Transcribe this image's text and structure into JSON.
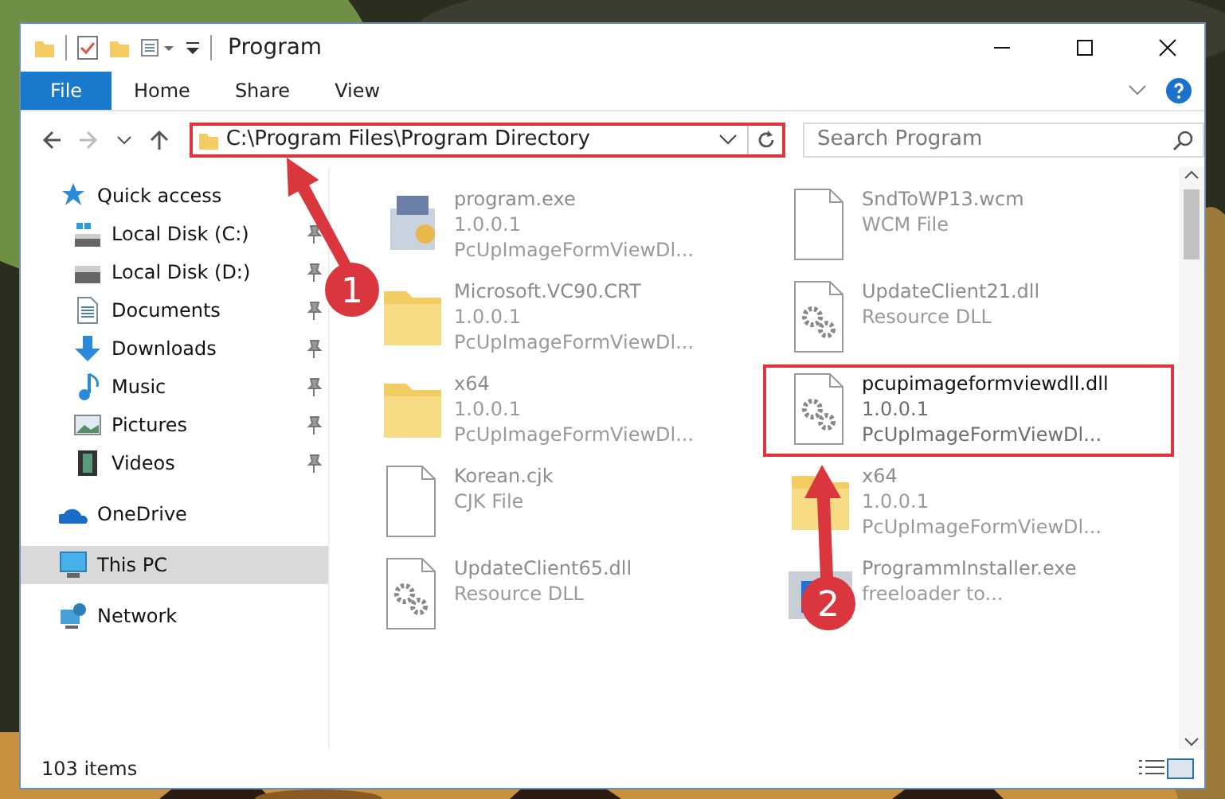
{
  "window": {
    "title": "Program"
  },
  "ribbon_tabs": [
    {
      "label": "File",
      "kind": "menu"
    },
    {
      "label": "Home",
      "kind": "tab"
    },
    {
      "label": "Share",
      "kind": "tab"
    },
    {
      "label": "View",
      "kind": "tab"
    }
  ],
  "address_bar": {
    "path": "C:\\Program Files\\Program Directory"
  },
  "search": {
    "placeholder": "Search Program"
  },
  "navigation": [
    {
      "label": "Quick access",
      "kind": "star",
      "selected": false,
      "children": [
        {
          "label": "Local Disk (C:)",
          "kind": "drive-c",
          "pinned": true,
          "selected": false
        },
        {
          "label": "Local Disk (D:)",
          "kind": "drive",
          "pinned": true,
          "selected": false
        },
        {
          "label": "Documents",
          "kind": "documents",
          "pinned": true,
          "selected": false
        },
        {
          "label": "Downloads",
          "kind": "downloads",
          "pinned": true,
          "selected": false
        },
        {
          "label": "Music",
          "kind": "music",
          "pinned": true,
          "selected": false
        },
        {
          "label": "Pictures",
          "kind": "pictures",
          "pinned": true,
          "selected": false
        },
        {
          "label": "Videos",
          "kind": "videos",
          "pinned": true,
          "selected": false
        }
      ]
    },
    {
      "label": "OneDrive",
      "kind": "cloud",
      "selected": false
    },
    {
      "label": "This PC",
      "kind": "pc",
      "selected": true
    },
    {
      "label": "Network",
      "kind": "network",
      "selected": false
    }
  ],
  "files": [
    {
      "name": "program.exe",
      "details": [
        "1.0.0.1",
        "PcUpImageFormViewDl..."
      ],
      "kind": "exe",
      "highlighted": false
    },
    {
      "name": "SndToWP13.wcm",
      "details": [
        "WCM File"
      ],
      "kind": "file",
      "highlighted": false
    },
    {
      "name": "Microsoft.VC90.CRT",
      "details": [
        "1.0.0.1",
        "PcUpImageFormViewDl..."
      ],
      "kind": "folder",
      "highlighted": false
    },
    {
      "name": "UpdateClient21.dll",
      "details": [
        "Resource DLL"
      ],
      "kind": "dll",
      "highlighted": false
    },
    {
      "name": "x64",
      "details": [
        "1.0.0.1",
        "PcUpImageFormViewDl..."
      ],
      "kind": "folder",
      "highlighted": false
    },
    {
      "name": "pcupimageformviewdll.dll",
      "details": [
        "1.0.0.1",
        "PcUpImageFormViewDl..."
      ],
      "kind": "dll",
      "highlighted": true
    },
    {
      "name": "Korean.cjk",
      "details": [
        "CJK File"
      ],
      "kind": "file",
      "highlighted": false
    },
    {
      "name": "x64",
      "details": [
        "1.0.0.1",
        "PcUpImageFormViewDl..."
      ],
      "kind": "folder",
      "highlighted": false
    },
    {
      "name": "UpdateClient65.dll",
      "details": [
        "Resource DLL"
      ],
      "kind": "dll",
      "highlighted": false
    },
    {
      "name": "ProgrammInstaller.exe",
      "details": [
        "freeloader to..."
      ],
      "kind": "installer",
      "highlighted": false
    }
  ],
  "status_bar": {
    "item_count": "103 items"
  },
  "annotations": [
    {
      "number": "1"
    },
    {
      "number": "2"
    }
  ]
}
